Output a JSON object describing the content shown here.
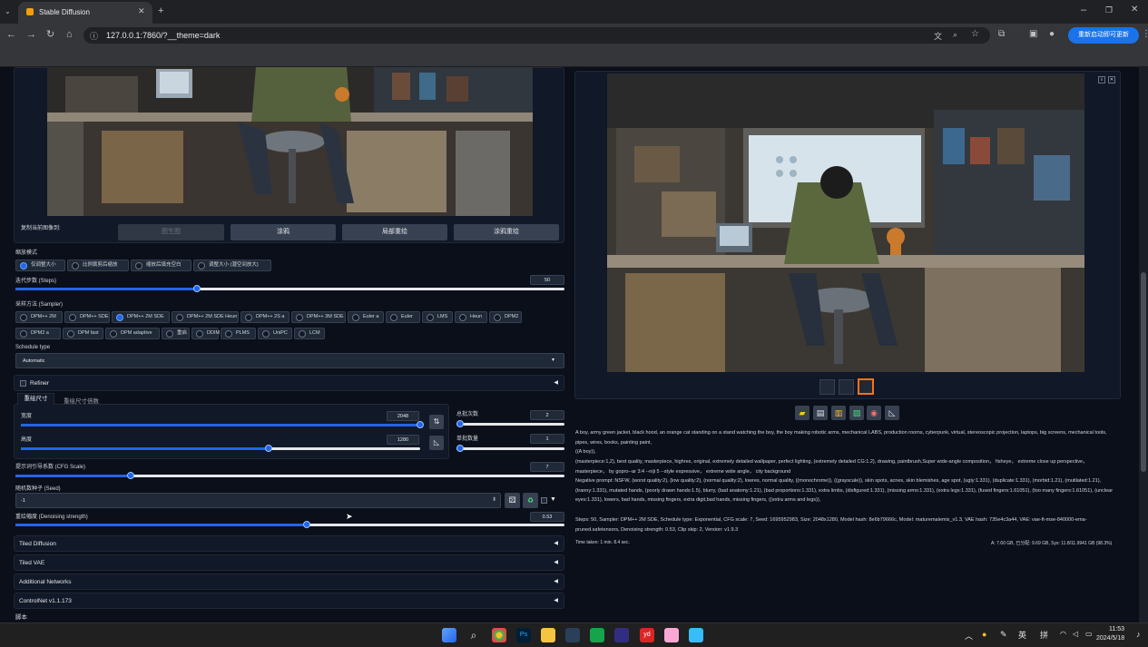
{
  "browser": {
    "tab_title": "Stable Diffusion",
    "url": "127.0.0.1:7860/?__theme=dark",
    "update_button": "重新启动即可更新"
  },
  "left": {
    "copy_image_to_label": "复制当前图像到:",
    "copy_buttons": [
      "图生图",
      "涂鸦",
      "局部重绘",
      "涂鸦重绘"
    ],
    "resize_mode_label": "缩放模式",
    "resize_modes": [
      "仅调整大小",
      "比例裁剪后缩放",
      "缩放后填充空白",
      "调整大小 (潜空间放大)"
    ],
    "steps_label": "迭代步数 (Steps)",
    "steps_value": "50",
    "steps_fraction": 0.33,
    "sampler_label": "采样方法 (Sampler)",
    "samplers_row1": [
      "DPM++ 2M",
      "DPM++ SDE",
      "DPM++ 2M SDE",
      "DPM++ 2M SDE Heun",
      "DPM++ 2S a",
      "DPM++ 3M SDE",
      "Euler a",
      "Euler",
      "LMS",
      "Heun",
      "DPM2"
    ],
    "samplers_row2": [
      "DPM2 a",
      "DPM fast",
      "DPM adaptive",
      "重启",
      "DDIM",
      "PLMS",
      "UniPC",
      "LCM"
    ],
    "schedule_type_label": "Schedule type",
    "schedule_type_value": "Automatic",
    "refiner_label": "Refiner",
    "resize_tabs": [
      "重绘尺寸",
      "重绘尺寸倍数"
    ],
    "width_label": "宽度",
    "width_value": "2048",
    "width_fraction": 1.0,
    "height_label": "高度",
    "height_value": "1280",
    "height_fraction": 0.62,
    "batch_count_label": "总批次数",
    "batch_count_value": "2",
    "batch_size_label": "单批数量",
    "batch_size_value": "1",
    "cfg_label": "提示词引导系数 (CFG Scale)",
    "cfg_value": "7",
    "cfg_fraction": 0.21,
    "seed_label": "随机数种子 (Seed)",
    "seed_value": "-1",
    "denoise_label": "重绘幅度 (Denoising strength)",
    "denoise_value": "0.53",
    "denoise_fraction": 0.53,
    "accordions": [
      "Tiled Diffusion",
      "Tiled VAE",
      "Additional Networks",
      "ControlNet v1.1.173"
    ],
    "script_label": "脚本"
  },
  "right": {
    "prompt_text": "A boy, army green jacket, black hood, an orange cat standing on a stand watching the boy, the boy making robotic arms, mechanical LABS, production rooms, cyberpunk, virtual, stereoscopic projection, laptops, big screens, mechanical tools, pipes, wires, books, painting paint,",
    "prompt_line2": "((A boy)),",
    "prompt_line3": "(masterpiece:1,2), best quality, masterpiece, highres, original, extremely detailed wallpaper, perfect lighting, (extremely detailed CG:1.2), drawing, paintbrush,Super wide-angle composition， fisheye， extreme close up perspective， masterpiece， by gopro--ar 3:4 --niji 5 --style expressive， extreme wide angle， city background",
    "negative_text": "Negative prompt: NSFW, (worst quality:2), (low quality:2), (normal quality:2), lowres, normal quality, ((monochrome)), ((grayscale)), skin spots, acnes, skin blemishes, age spot, (ugly:1.331), (duplicate:1.331), (morbid:1.21), (mutilated:1.21), (tranny:1.331), mutated hands, (poorly drawn hands:1.5), blurry, (bad anatomy:1.21), (bad proportions:1.331), extra limbs, (disfigured:1.331), (missing arms:1.331), (extra legs:1.331), (fused fingers:1.61051), (too many fingers:1.61051), (unclear eyes:1.331), lowers, bad hands, missing fingers, extra digit,bad hands, missing fingers, ((extra arms and legs)),",
    "params_text": "Steps: 50, Sampler: DPM++ 2M SDE, Schedule type: Exponential, CFG scale: 7, Seed: 1695952983, Size: 2048x1280, Model hash: 8e6b79666c, Model: maturemalemix_v1.3, VAE hash: 735e4c3a44, VAE: vae-ft-mse-840000-ema-pruned.safetensors, Denoising strength: 0.53, Clip skip: 2, Version: v1.9.3",
    "time_taken": "Time taken: 1 min. 8.4 sec.",
    "vram": "A: 7.60 GB, 已分配: 9.69 GB, Sys: 11.8/11.9941 GB (98.3%)"
  },
  "taskbar": {
    "ime_en": "英",
    "ime_pinyin": "拼",
    "time": "11:53",
    "date": "2024/5/18"
  },
  "colors": {
    "accent": "#2563eb",
    "bg": "#0b0f19",
    "panel": "#111827"
  }
}
